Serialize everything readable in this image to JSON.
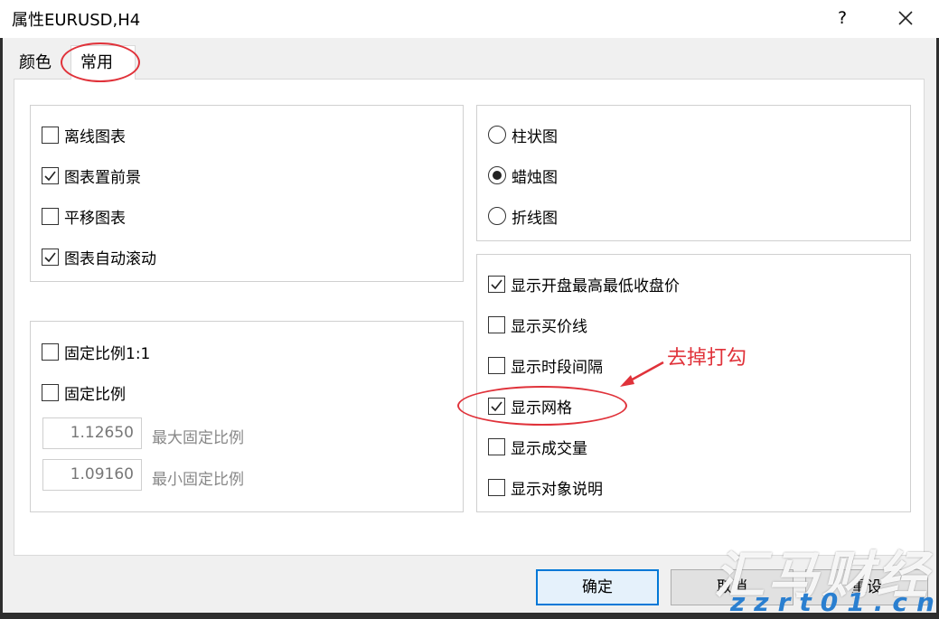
{
  "window": {
    "title": "属性EURUSD,H4",
    "help_label": "?"
  },
  "tabs": [
    {
      "label": "颜色"
    },
    {
      "label": "常用",
      "active": true
    }
  ],
  "chart_options": [
    {
      "label": "离线图表",
      "checked": false
    },
    {
      "label": "图表置前景",
      "checked": true
    },
    {
      "label": "平移图表",
      "checked": false
    },
    {
      "label": "图表自动滚动",
      "checked": true
    }
  ],
  "scale_options": {
    "fixed_1_1": {
      "label": "固定比例1:1",
      "checked": false
    },
    "fixed": {
      "label": "固定比例",
      "checked": false
    },
    "max": {
      "value": "1.12650",
      "label": "最大固定比例"
    },
    "min": {
      "value": "1.09160",
      "label": "最小固定比例"
    }
  },
  "chart_types": [
    {
      "label": "柱状图",
      "selected": false
    },
    {
      "label": "蜡烛图",
      "selected": true
    },
    {
      "label": "折线图",
      "selected": false
    }
  ],
  "display_options": [
    {
      "label": "显示开盘最高最低收盘价",
      "checked": true
    },
    {
      "label": "显示买价线",
      "checked": false
    },
    {
      "label": "显示时段间隔",
      "checked": false
    },
    {
      "label": "显示网格",
      "checked": true
    },
    {
      "label": "显示成交量",
      "checked": false
    },
    {
      "label": "显示对象说明",
      "checked": false
    }
  ],
  "buttons": {
    "ok": "确定",
    "cancel": "取消",
    "reset": "重设"
  },
  "annotation": {
    "text": "去掉打勾",
    "color": "#e0323a"
  },
  "watermark": {
    "brand": "汇马财经",
    "url": "zzrt01.cn"
  },
  "colors": {
    "accent": "#0078d7",
    "annotation": "#e0323a",
    "watermark_url": "#2a7fd0"
  }
}
